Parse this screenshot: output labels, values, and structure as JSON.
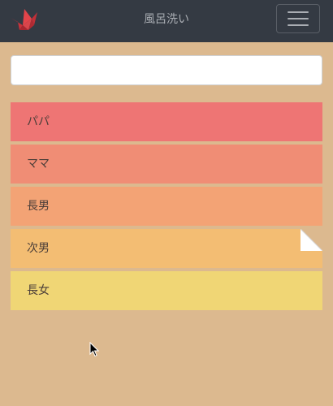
{
  "header": {
    "title": "風呂洗い",
    "logo_icon": "paper-crane-icon",
    "menu_icon": "hamburger-menu-icon"
  },
  "search": {
    "value": "",
    "placeholder": ""
  },
  "members": [
    {
      "label": "パパ",
      "color": "#ee7574"
    },
    {
      "label": "ママ",
      "color": "#f08d75"
    },
    {
      "label": "長男",
      "color": "#f3a375"
    },
    {
      "label": "次男",
      "color": "#f3bd73",
      "folded": true
    },
    {
      "label": "長女",
      "color": "#f0d675"
    }
  ],
  "colors": {
    "navbar": "#343a43",
    "background": "#dcb98f",
    "logo": "#e2444a"
  }
}
